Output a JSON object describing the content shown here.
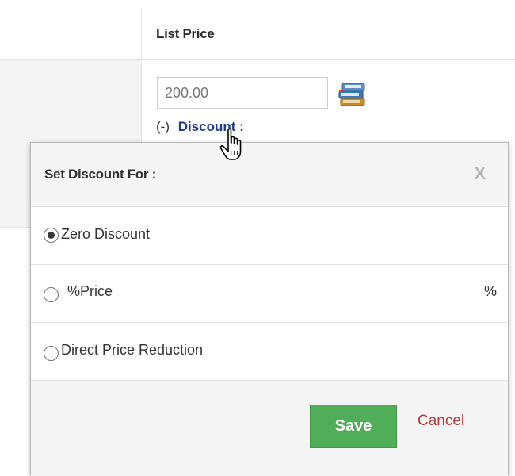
{
  "list_price": {
    "header": "List Price",
    "value": "200.00",
    "book_icon": "books-icon",
    "discount_sign": "(-)",
    "discount_link": "Discount :"
  },
  "cursor": "hand-pointer-icon",
  "discount_popup": {
    "title": "Set Discount For :",
    "close_label": "X",
    "options": [
      {
        "label": "Zero Discount",
        "checked": true
      },
      {
        "label": "%Price",
        "checked": false,
        "suffix": "%"
      },
      {
        "label": "Direct Price Reduction",
        "checked": false
      }
    ],
    "save_label": "Save",
    "cancel_label": "Cancel"
  },
  "colors": {
    "save_green": "#4fae57",
    "cancel_red": "#b43a3a",
    "link_blue": "#1f3a8a",
    "close_gray": "#b5b5b5"
  }
}
